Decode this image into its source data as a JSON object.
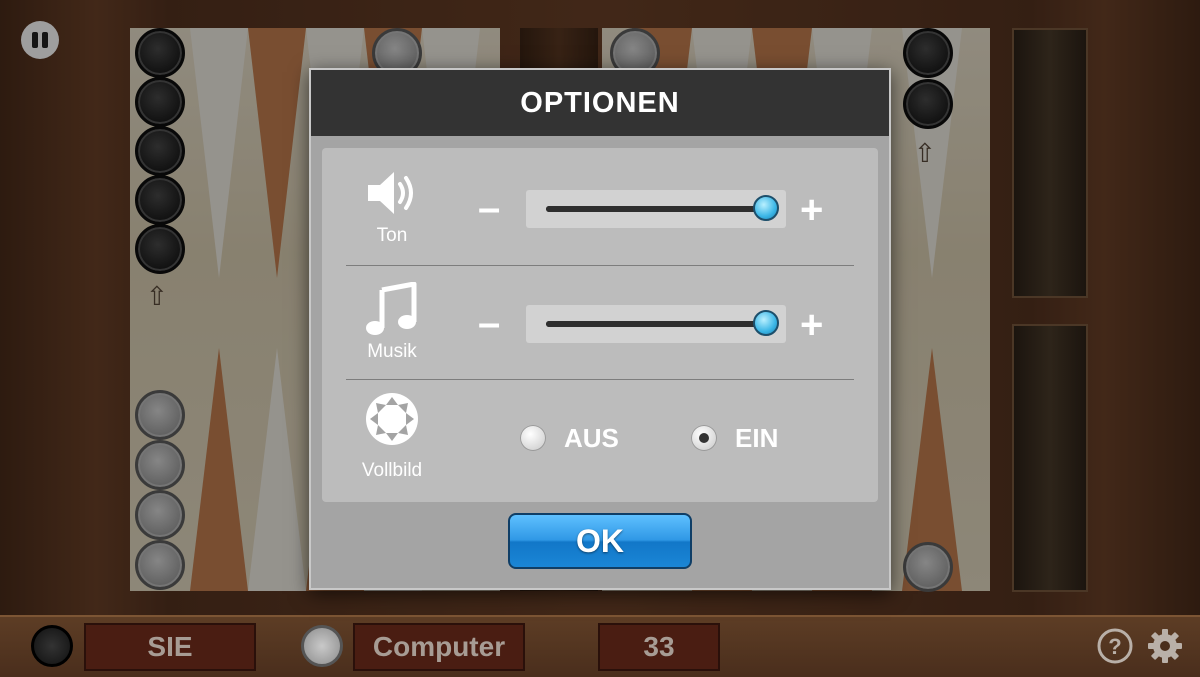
{
  "dialog": {
    "title": "OPTIONEN",
    "options": [
      {
        "label": "Ton",
        "icon": "speaker-icon",
        "type": "slider",
        "value_percent": 100,
        "minus": "–",
        "plus": "+"
      },
      {
        "label": "Musik",
        "icon": "music-note-icon",
        "type": "slider",
        "value_percent": 100,
        "minus": "–",
        "plus": "+"
      }
    ],
    "fullscreen": {
      "label": "Vollbild",
      "icon": "fullscreen-icon",
      "off_label": "AUS",
      "on_label": "EIN",
      "selected": "EIN"
    },
    "ok_label": "OK"
  },
  "bottom_bar": {
    "player_label": "SIE",
    "opponent_label": "Computer",
    "score": "33",
    "help_icon": "help-icon",
    "settings_icon": "gear-icon"
  },
  "colors": {
    "dialog_header": "#333333",
    "ok_button": "#2f98e6",
    "slider_knob": "#3bb6e6",
    "score_box": "#4a1d12"
  }
}
